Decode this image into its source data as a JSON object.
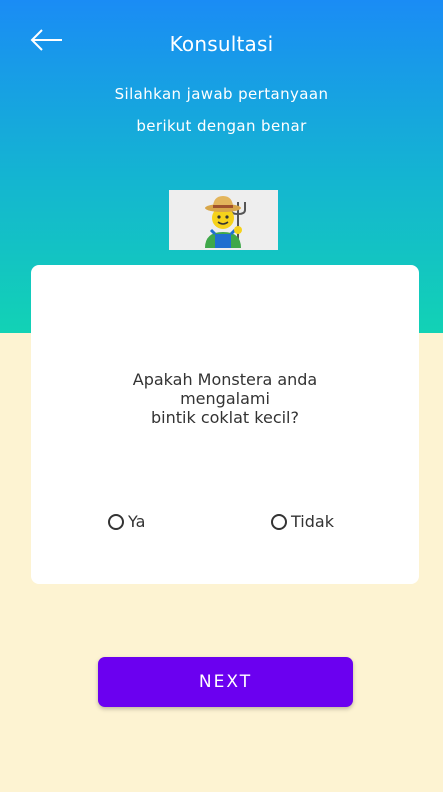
{
  "header": {
    "back_icon": "arrow-left-icon",
    "title": "Konsultasi",
    "subtitle_line1": "Silahkan jawab pertanyaan",
    "subtitle_line2": "berikut dengan benar",
    "illustration_icon": "farmer-icon"
  },
  "question": {
    "line1": "Apakah Monstera anda",
    "line2": "mengalami",
    "line3": "bintik coklat kecil?"
  },
  "options": [
    {
      "label": "Ya",
      "selected": false
    },
    {
      "label": "Tidak",
      "selected": false
    }
  ],
  "next_button": {
    "label": "NEXT"
  },
  "colors": {
    "header_top": "#1a8cf5",
    "header_bottom": "#12d2b5",
    "background": "#fdf3d2",
    "button": "#6b00f0"
  }
}
